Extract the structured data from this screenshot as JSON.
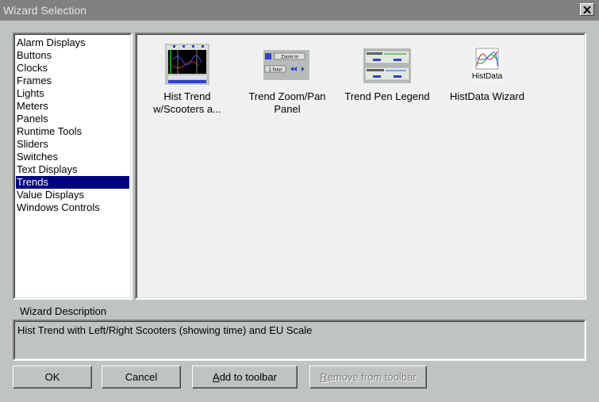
{
  "window": {
    "title": "Wizard Selection"
  },
  "categories": [
    "Alarm Displays",
    "Buttons",
    "Clocks",
    "Frames",
    "Lights",
    "Meters",
    "Panels",
    "Runtime Tools",
    "Sliders",
    "Switches",
    "Text Displays",
    "Trends",
    "Value Displays",
    "Windows Controls"
  ],
  "selected_category": "Trends",
  "wizards": [
    {
      "label": "Hist Trend w/Scooters a...",
      "icon": "hist-trend-thumbnail"
    },
    {
      "label": "Trend Zoom/Pan Panel",
      "icon": "trend-zoom-pan-thumbnail",
      "thumb_text": {
        "zoom": "Zoom in",
        "hour": "1 hour"
      }
    },
    {
      "label": "Trend Pen Legend",
      "icon": "trend-pen-legend-thumbnail"
    },
    {
      "label": "HistData Wizard",
      "icon": "histdata-thumbnail",
      "thumb_text": "HistData"
    }
  ],
  "description": {
    "label": "Wizard Description",
    "text": "Hist Trend with Left/Right Scooters (showing time) and EU Scale"
  },
  "buttons": {
    "ok": "OK",
    "cancel": "Cancel",
    "add_first": "A",
    "add_rest": "dd to toolbar",
    "remove_first": "R",
    "remove_rest": "emove from  toolbar"
  }
}
